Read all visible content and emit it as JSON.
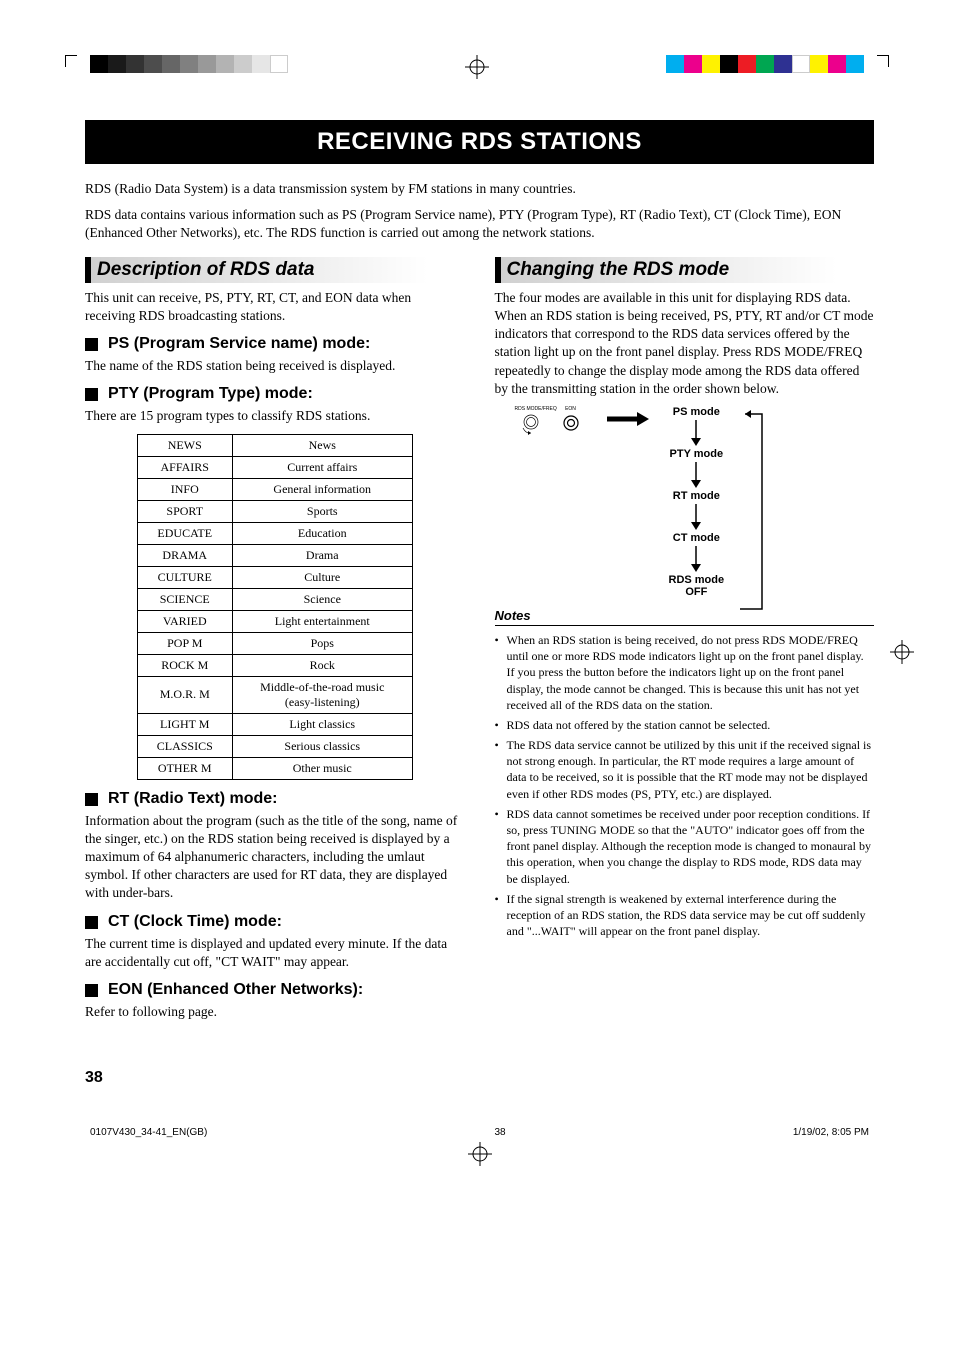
{
  "banner_title": "RECEIVING RDS STATIONS",
  "intro1": "RDS (Radio Data System) is a data transmission system by FM stations in many countries.",
  "intro2": "RDS data contains various information such as PS (Program Service name), PTY (Program Type), RT (Radio Text), CT (Clock Time), EON (Enhanced Other Networks), etc. The RDS function is carried out among the network stations.",
  "left": {
    "section1_title": "Description of RDS data",
    "section1_body": "This unit can receive, PS, PTY, RT, CT, and EON data when receiving RDS broadcasting stations.",
    "ps_head": "PS (Program Service name) mode:",
    "ps_body": "The name of the RDS station being received is displayed.",
    "pty_head": "PTY (Program Type) mode:",
    "pty_body": "There are 15 program types to classify RDS stations.",
    "pty_table": [
      {
        "code": "NEWS",
        "desc": "News"
      },
      {
        "code": "AFFAIRS",
        "desc": "Current affairs"
      },
      {
        "code": "INFO",
        "desc": "General information"
      },
      {
        "code": "SPORT",
        "desc": "Sports"
      },
      {
        "code": "EDUCATE",
        "desc": "Education"
      },
      {
        "code": "DRAMA",
        "desc": "Drama"
      },
      {
        "code": "CULTURE",
        "desc": "Culture"
      },
      {
        "code": "SCIENCE",
        "desc": "Science"
      },
      {
        "code": "VARIED",
        "desc": "Light entertainment"
      },
      {
        "code": "POP M",
        "desc": "Pops"
      },
      {
        "code": "ROCK M",
        "desc": "Rock"
      },
      {
        "code": "M.O.R. M",
        "desc": "Middle-of-the-road music (easy-listening)"
      },
      {
        "code": "LIGHT M",
        "desc": "Light classics"
      },
      {
        "code": "CLASSICS",
        "desc": "Serious classics"
      },
      {
        "code": "OTHER M",
        "desc": "Other music"
      }
    ],
    "rt_head": "RT (Radio Text) mode:",
    "rt_body": "Information about the program (such as the title of the song, name of the singer, etc.) on the RDS station being received is displayed by a maximum of 64 alphanumeric characters, including the umlaut symbol. If other characters are used for RT data, they are displayed with under-bars.",
    "ct_head": "CT (Clock Time) mode:",
    "ct_body": "The current time is displayed and updated every minute. If the data are accidentally cut off, \"CT WAIT\" may appear.",
    "eon_head": "EON (Enhanced Other Networks):",
    "eon_body": "Refer to following page."
  },
  "right": {
    "section_title": "Changing the RDS mode",
    "body": "The four modes are available in this unit for displaying RDS data. When an RDS station is being received, PS, PTY, RT and/or CT mode indicators that correspond to the RDS data services offered by the station light up on the front panel display. Press RDS MODE/FREQ repeatedly to change the display mode among the RDS data offered by the transmitting station in the order shown below.",
    "btn1_label": "RDS MODE/FREQ",
    "btn2_label": "EON",
    "modes": [
      "PS mode",
      "PTY mode",
      "RT mode",
      "CT mode",
      "RDS mode OFF"
    ],
    "notes_head": "Notes",
    "notes": [
      "When an RDS station is being received, do not press RDS MODE/FREQ until one or more RDS mode indicators light up on the front panel display. If you press the button before the indicators light up on the front panel display, the mode cannot be changed. This is because this unit has not yet received all of the RDS data on the station.",
      "RDS data not offered by the station cannot be selected.",
      "The RDS data service cannot be utilized by this unit if the received signal is not strong enough. In particular, the RT mode requires a large amount of data to be received, so it is possible that the RT mode may not be displayed even if other RDS modes (PS, PTY, etc.) are displayed.",
      "RDS data cannot sometimes be received under poor reception conditions. If so, press TUNING MODE so that the \"AUTO\" indicator goes off from the front panel display. Although the reception mode is changed to monaural by this operation, when you change the display to RDS mode, RDS data may be displayed.",
      "If the signal strength is weakened by external interference during the reception of an RDS station, the RDS data service may be cut off suddenly and \"...WAIT\" will appear on the front panel display."
    ]
  },
  "page_number": "38",
  "footer_left": "0107V430_34-41_EN(GB)",
  "footer_center": "38",
  "footer_right": "1/19/02, 8:05 PM"
}
